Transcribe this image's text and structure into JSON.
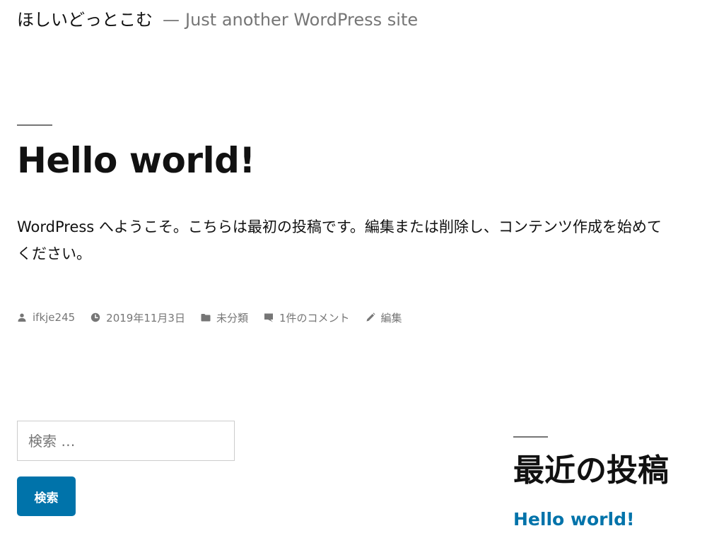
{
  "site": {
    "title": "ほしいどっとこむ",
    "separator": "—",
    "description": "Just another WordPress site"
  },
  "post": {
    "title": "Hello world!",
    "content": "WordPress へようこそ。こちらは最初の投稿です。編集または削除し、コンテンツ作成を始めてください。",
    "meta": {
      "author": "ifkje245",
      "date": "2019年11月3日",
      "category": "未分類",
      "comments": "1件のコメント",
      "edit": "編集"
    }
  },
  "search": {
    "placeholder": "検索 …",
    "value": "",
    "button_label": "検索"
  },
  "recent_posts": {
    "title": "最近の投稿",
    "items": [
      {
        "label": "Hello world!"
      }
    ]
  },
  "colors": {
    "accent": "#0073aa",
    "text": "#111111",
    "muted": "#767676"
  },
  "icons": {
    "author": "person-icon",
    "date": "clock-icon",
    "category": "folder-icon",
    "comments": "comment-icon",
    "edit": "pencil-icon"
  }
}
